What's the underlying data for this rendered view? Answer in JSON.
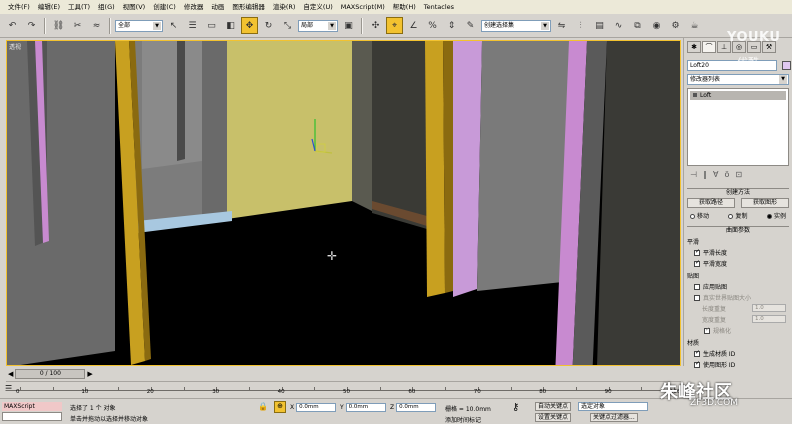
{
  "menubar": {
    "items": [
      "文件(F)",
      "编辑(E)",
      "工具(T)",
      "组(G)",
      "视图(V)",
      "创建(C)",
      "修改器",
      "动画",
      "图形编辑器",
      "渲染(R)",
      "自定义(U)",
      "MAXScript(M)",
      "帮助(H)",
      "Tentacles"
    ]
  },
  "toolbar": {
    "selection_filter": "全部",
    "reference_coord": "局部",
    "named_selection": "创建选择集",
    "icons": [
      "undo-icon",
      "redo-icon",
      "select-link-icon",
      "unlink-icon",
      "bind-spacewarp-icon",
      "select-icon",
      "select-by-name-icon",
      "rect-region-icon",
      "window-crossing-icon",
      "move-icon",
      "rotate-icon",
      "scale-icon",
      "mirror-icon",
      "align-icon",
      "snap-icon",
      "angle-snap-icon",
      "percent-snap-icon",
      "spinner-snap-icon"
    ]
  },
  "viewport": {
    "label": "透视",
    "colors": {
      "wall_yellow": "#c8c06a",
      "wall_gray": "#5c5c5c",
      "door_frame": "#c8a020",
      "purple": "#c89ad8",
      "floor": "#000000",
      "baseboard_blue": "#a8c8e0",
      "baseboard_brown": "#6a4a30"
    }
  },
  "command_panel": {
    "tabs": [
      "create-icon",
      "modify-icon",
      "hierarchy-icon",
      "motion-icon",
      "display-icon",
      "utilities-icon"
    ],
    "object_name": "Loft20",
    "modifier_list_label": "修改器列表",
    "stack_items": [
      "Loft"
    ],
    "creation_method": {
      "title": "创建方法",
      "get_path": "获取路径",
      "get_shape": "获取图形",
      "options": [
        "移动",
        "复制",
        "实例"
      ],
      "selected": "实例"
    },
    "surface_params": {
      "title": "曲面参数",
      "smoothing_title": "平滑",
      "smooth_length": "平滑长度",
      "smooth_width": "平滑宽度",
      "mapping_title": "贴图",
      "apply_mapping": "应用贴图",
      "real_world_map_size": "真实世界贴图大小",
      "length_repeat": "长度重复",
      "width_repeat": "宽度重复",
      "length_value": "1.0",
      "width_value": "1.0",
      "normalize": "规格化",
      "materials_title": "材质",
      "gen_material_ids": "生成材质 ID",
      "use_shape_ids": "使用图形 ID"
    }
  },
  "timeslider": {
    "frame_label": "0 / 100",
    "ticks": [
      "0",
      "10",
      "20",
      "30",
      "40",
      "50",
      "60",
      "70",
      "80",
      "90",
      "100"
    ]
  },
  "status": {
    "maxscript_label": "MAXScript",
    "selection_text": "选择了 1 个 对象",
    "prompt_text": "单击并拖动以选择并移动对象",
    "x_label": "X",
    "x_value": "0.0mm",
    "y_label": "Y",
    "y_value": "0.0mm",
    "z_label": "Z",
    "z_value": "0.0mm",
    "grid_text": "栅格 = 10.0mm",
    "add_time_tag": "添加时间标记",
    "auto_key": "自动关键点",
    "selected_object": "选定对象",
    "set_key": "设置关键点",
    "key_filters": "关键点过滤器..."
  },
  "watermarks": {
    "youku": "YOUKU",
    "youku_cn": "优酷",
    "site": "朱峰社区",
    "domain": "ZF3D.COM"
  }
}
